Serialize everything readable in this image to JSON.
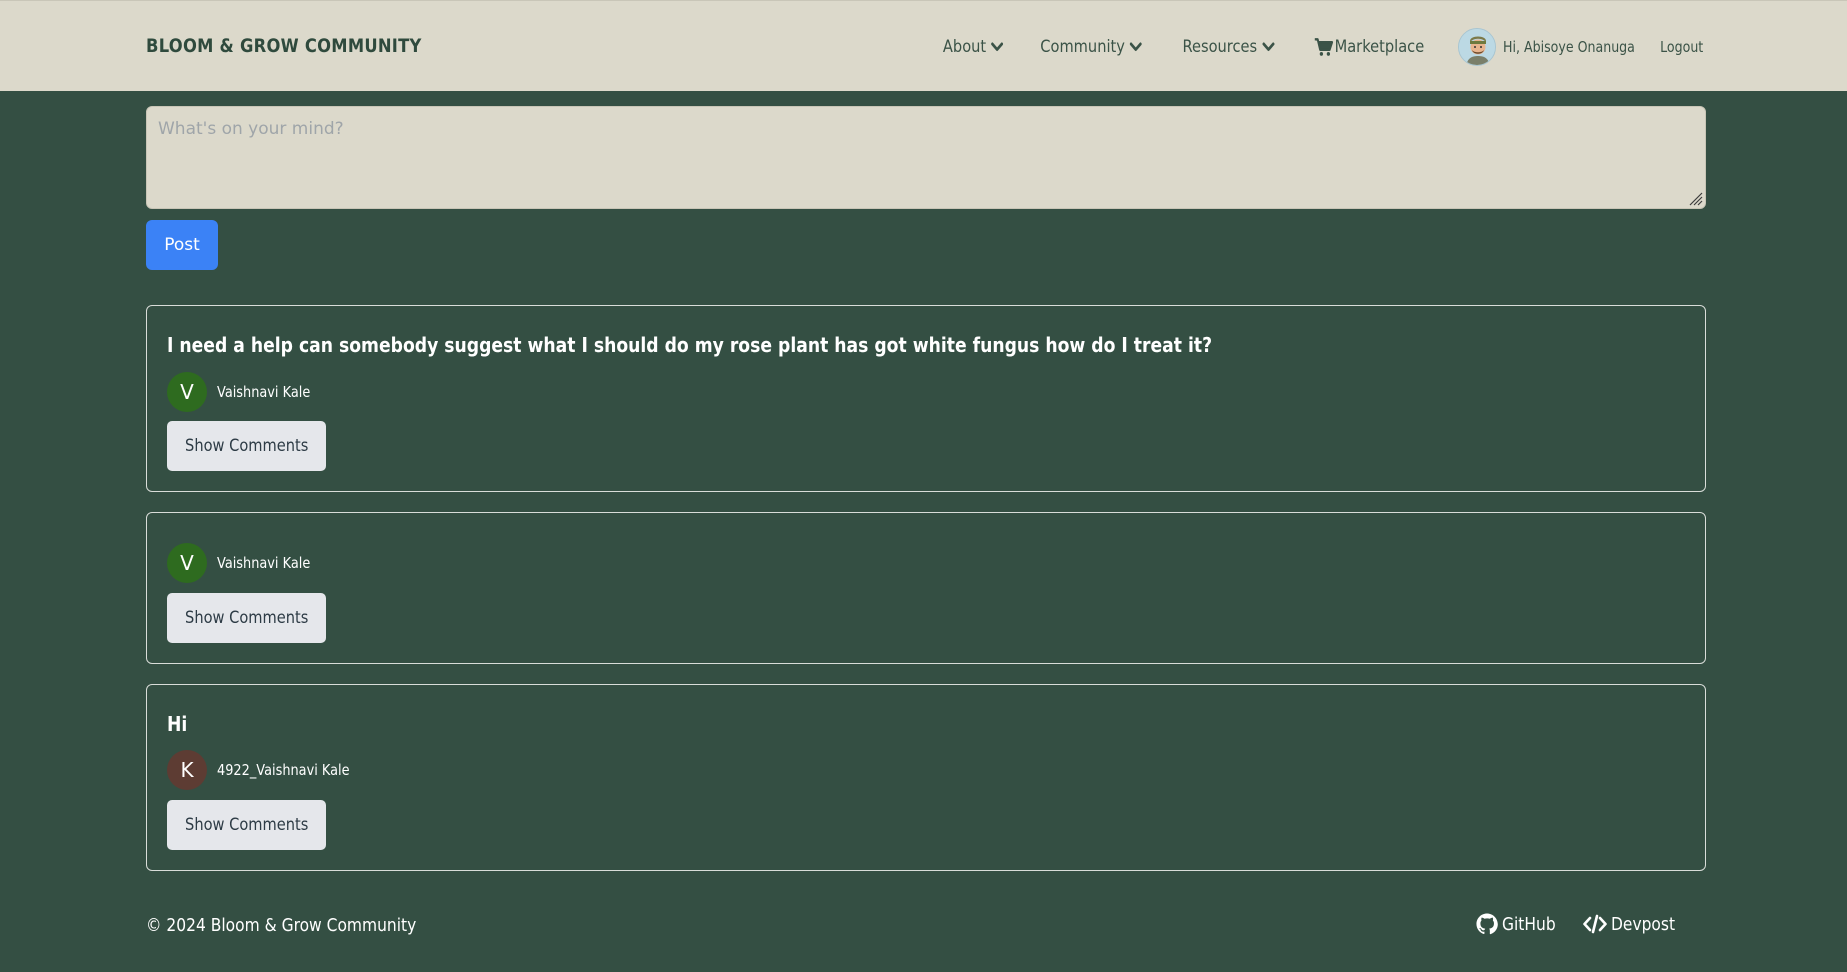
{
  "header": {
    "brand": "BLOOM & GROW COMMUNITY",
    "nav": [
      {
        "label": "About",
        "icon": "chevron-down-icon"
      },
      {
        "label": "Community",
        "icon": "chevron-down-icon"
      },
      {
        "label": "Resources",
        "icon": "chevron-down-icon"
      }
    ],
    "marketplace_label": "Marketplace",
    "greeting": "Hi, Abisoye Onanuga",
    "logout_label": "Logout"
  },
  "composer": {
    "placeholder": "What's on your mind?",
    "post_label": "Post",
    "accent": "#3b82f6"
  },
  "posts": [
    {
      "title": "I need a help can somebody suggest what I should do my rose plant has got white fungus how do I treat it?",
      "author_initial": "V",
      "author_name": "Vaishnavi Kale",
      "avatar_color": "#2e6b1f",
      "button_label": "Show Comments"
    },
    {
      "title": "",
      "author_initial": "V",
      "author_name": "Vaishnavi Kale",
      "avatar_color": "#2e6b1f",
      "button_label": "Show Comments"
    },
    {
      "title": "Hi",
      "author_initial": "K",
      "author_name": "4922_Vaishnavi Kale",
      "avatar_color": "#5d3c33",
      "button_label": "Show Comments"
    }
  ],
  "footer": {
    "copyright": "© 2024 Bloom & Grow Community",
    "links": [
      {
        "label": "GitHub",
        "icon": "github-icon"
      },
      {
        "label": "Devpost",
        "icon": "code-icon"
      }
    ]
  }
}
